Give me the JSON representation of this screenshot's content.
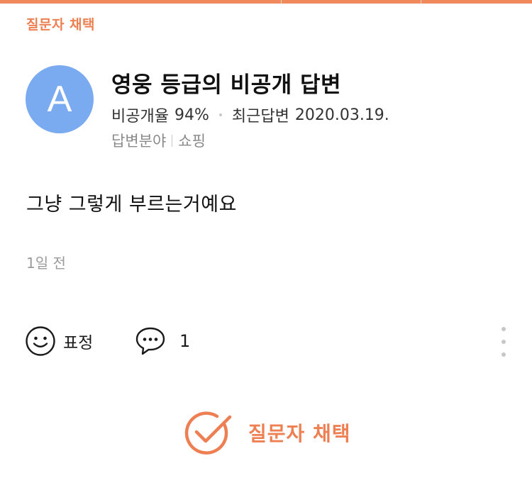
{
  "header": {
    "chosen_tag": "질문자 채택"
  },
  "answerer": {
    "avatar_letter": "A",
    "title": "영웅 등급의 비공개 답변",
    "private_rate_label": "비공개율",
    "private_rate_value": "94%",
    "recent_answer_label": "최근답변",
    "recent_answer_date": "2020.03.19.",
    "field_label": "답변분야",
    "field_value": "쇼핑"
  },
  "answer": {
    "body": "그냥 그렇게 부르는거예요",
    "time_ago": "1일 전"
  },
  "actions": {
    "emoji_label": "표정",
    "comment_count": "1"
  },
  "choose_button": {
    "label": "질문자 채택"
  },
  "colors": {
    "accent": "#ee7f52",
    "avatar_bg": "#7aaaf0",
    "muted_text": "#9a9a9a"
  },
  "icons": [
    "smiley-icon",
    "speech-bubble-icon",
    "more-vertical-icon",
    "check-circle-icon"
  ]
}
